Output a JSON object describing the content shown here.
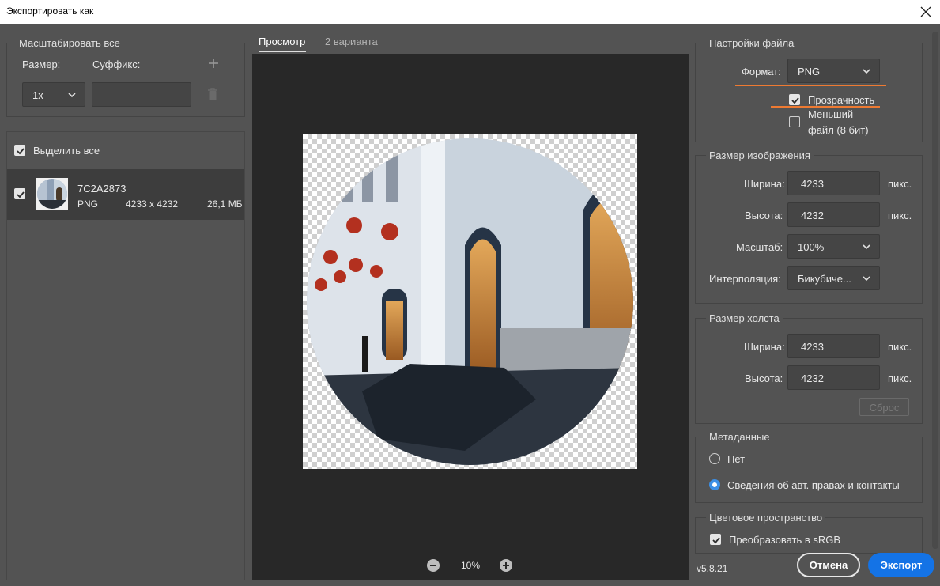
{
  "window": {
    "title": "Экспортировать как"
  },
  "left": {
    "scale_all": {
      "title": "Масштабировать все",
      "size_label": "Размер:",
      "suffix_label": "Суффикс:",
      "size_value": "1x",
      "suffix_value": ""
    },
    "select_all_label": "Выделить все",
    "asset": {
      "name": "7C2A2873",
      "format": "PNG",
      "dimensions": "4233 x 4232",
      "size": "26,1 МБ",
      "checked": true
    }
  },
  "center": {
    "tabs": [
      {
        "label": "Просмотр",
        "active": true
      },
      {
        "label": "2 варианта",
        "active": false
      }
    ],
    "zoom": "10%"
  },
  "right": {
    "file_settings": {
      "title": "Настройки файла",
      "format_label": "Формат:",
      "format_value": "PNG",
      "transparency_label": "Прозрачность",
      "transparency_checked": true,
      "smaller_line1": "Меньший",
      "smaller_line2": "файл (8 бит)",
      "smaller_checked": false
    },
    "image_size": {
      "title": "Размер изображения",
      "width_label": "Ширина:",
      "width_value": "4233",
      "height_label": "Высота:",
      "height_value": "4232",
      "scale_label": "Масштаб:",
      "scale_value": "100%",
      "interp_label": "Интерполяция:",
      "interp_value": "Бикубиче...",
      "unit": "пикс."
    },
    "canvas_size": {
      "title": "Размер холста",
      "width_label": "Ширина:",
      "width_value": "4233",
      "height_label": "Высота:",
      "height_value": "4232",
      "unit": "пикс.",
      "reset_label": "Сброс"
    },
    "metadata": {
      "title": "Метаданные",
      "option_none": "Нет",
      "option_copyright": "Сведения об авт. правах и контакты",
      "selected": "copyright"
    },
    "color_space": {
      "title": "Цветовое пространство",
      "convert_label": "Преобразовать в sRGB",
      "convert_checked": true
    }
  },
  "footer": {
    "version": "v5.8.21",
    "cancel_label": "Отмена",
    "export_label": "Экспорт"
  },
  "colors": {
    "accent_blue": "#1473e6",
    "highlight_orange": "#ee7a32",
    "panel_bg": "#535353",
    "preview_bg": "#282828"
  }
}
